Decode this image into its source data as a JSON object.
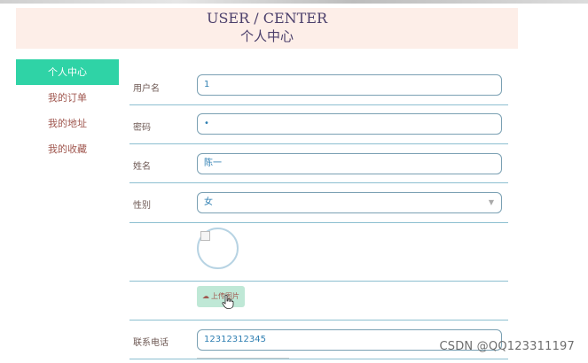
{
  "header": {
    "title_en": "USER / CENTER",
    "title_zh": "个人中心"
  },
  "sidebar": {
    "items": [
      {
        "label": "个人中心"
      },
      {
        "label": "我的订单"
      },
      {
        "label": "我的地址"
      },
      {
        "label": "我的收藏"
      }
    ]
  },
  "form": {
    "username": {
      "label": "用户名",
      "value": "1"
    },
    "password": {
      "label": "密码",
      "value": "•"
    },
    "name": {
      "label": "姓名",
      "value": "陈一"
    },
    "gender": {
      "label": "性别",
      "value": "女"
    },
    "upload_label": "上传图片",
    "phone": {
      "label": "联系电话",
      "value": "12312312345"
    }
  },
  "watermark": "CSDN @QQ123311197",
  "icons": {
    "upload": "cloud-upload-icon",
    "dropdown": "chevron-down-icon",
    "cursor": "hand-pointer-icon"
  },
  "colors": {
    "active_tab": "#2fd3a6",
    "header_bg": "#fdeee8",
    "upload_bg": "#bfe8d6"
  }
}
